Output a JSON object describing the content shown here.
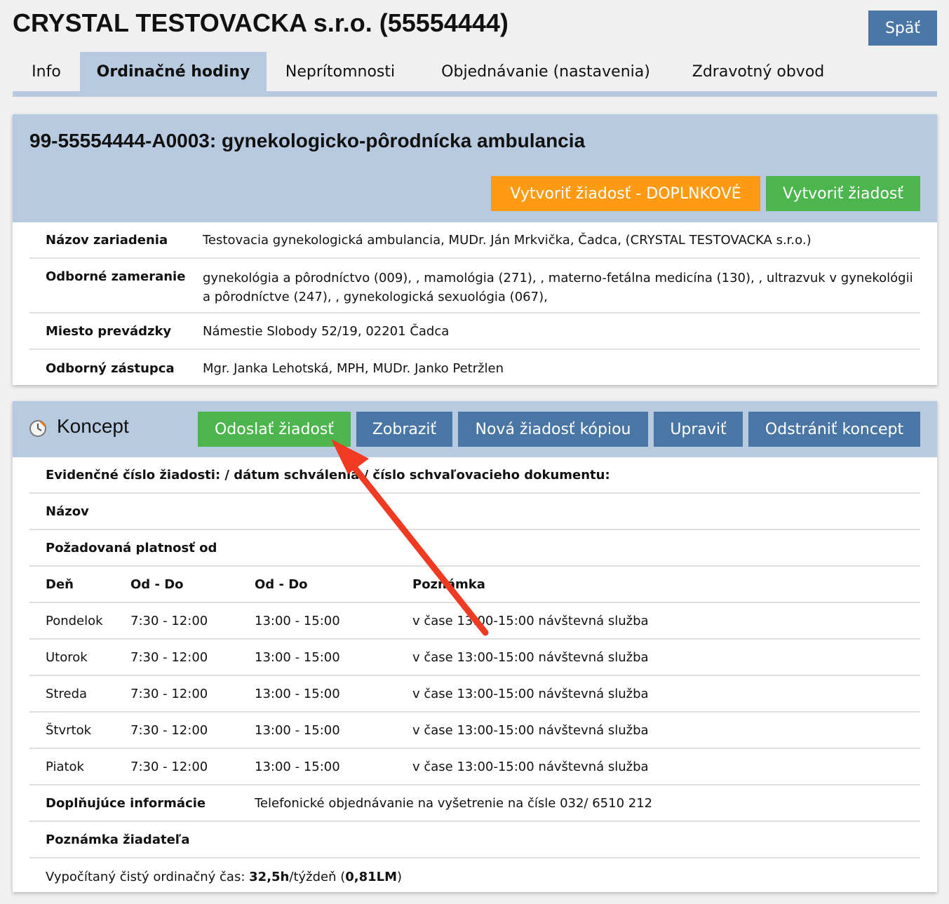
{
  "header": {
    "title": "CRYSTAL TESTOVACKA s.r.o. (55554444)",
    "back_label": "Späť"
  },
  "tabs": [
    {
      "label": "Info"
    },
    {
      "label": "Ordinačné hodiny",
      "active": true
    },
    {
      "label": "Neprítomnosti"
    },
    {
      "label": "Objednávanie (nastavenia)"
    },
    {
      "label": "Zdravotný obvod"
    }
  ],
  "unit": {
    "title": "99-55554444-A0003: gynekologicko-pôrodnícka ambulancia",
    "btn_supplementary": "Vytvoriť žiadosť - DOPLNKOVÉ",
    "btn_create": "Vytvoriť žiadosť",
    "fields": [
      {
        "label": "Názov zariadenia",
        "value": "Testovacia gynekologická ambulancia, MUDr. Ján Mrkvička, Čadca, (CRYSTAL TESTOVACKA s.r.o.)"
      },
      {
        "label": "Odborné zameranie",
        "value": "gynekológia a pôrodníctvo (009), , mamológia (271), , materno-fetálna medicína (130), , ultrazvuk v gynekológii a pôrodníctve (247), , gynekologická sexuológia (067),"
      },
      {
        "label": "Miesto prevádzky",
        "value": "Námestie Slobody 52/19, 02201 Čadca"
      },
      {
        "label": "Odborný zástupca",
        "value": "Mgr. Janka Lehotská, MPH, MUDr. Janko Petržlen"
      }
    ]
  },
  "concept": {
    "label": "Koncept",
    "btn_send": "Odoslať žiadosť",
    "btn_show": "Zobraziť",
    "btn_copy": "Nová žiadosť kópiou",
    "btn_edit": "Upraviť",
    "btn_delete": "Odstrániť koncept",
    "evidence_label": "Evidenčné číslo žiadosti: / dátum schválenia / číslo schvaľovacieho dokumentu:",
    "name_label": "Názov",
    "validity_label": "Požadovaná platnosť od",
    "col_day": "Deň",
    "col_from_to_1": "Od - Do",
    "col_from_to_2": "Od - Do",
    "col_note": "Poznámka",
    "schedule": [
      {
        "day": "Pondelok",
        "t1": "7:30 - 12:00",
        "t2": "13:00 - 15:00",
        "note": "v čase 13:00-15:00 návštevná služba"
      },
      {
        "day": "Utorok",
        "t1": "7:30 - 12:00",
        "t2": "13:00 - 15:00",
        "note": "v čase 13:00-15:00 návštevná služba"
      },
      {
        "day": "Streda",
        "t1": "7:30 - 12:00",
        "t2": "13:00 - 15:00",
        "note": "v čase 13:00-15:00 návštevná služba"
      },
      {
        "day": "Štvrtok",
        "t1": "7:30 - 12:00",
        "t2": "13:00 - 15:00",
        "note": "v čase 13:00-15:00 návštevná služba"
      },
      {
        "day": "Piatok",
        "t1": "7:30 - 12:00",
        "t2": "13:00 - 15:00",
        "note": "v čase 13:00-15:00 návštevná služba"
      }
    ],
    "extra_label": "Doplňujúce informácie",
    "extra_value": "Telefonické objednávanie na vyšetrenie na čísle 032/ 6510 212",
    "applicant_note_label": "Poznámka žiadateľa",
    "calc_prefix": "Vypočítaný čistý ordinačný čas: ",
    "calc_hours": "32,5h",
    "calc_mid": "/týždeň (",
    "calc_lm": "0,81LM",
    "calc_suffix": ")"
  },
  "colors": {
    "accent_blue": "#4a76a6",
    "panel_head": "#b8cae0",
    "green": "#4db54d",
    "orange": "#ff9a12",
    "annotation_arrow": "#f03a22"
  },
  "icons": [
    "clock-icon",
    "annotation-arrow"
  ]
}
